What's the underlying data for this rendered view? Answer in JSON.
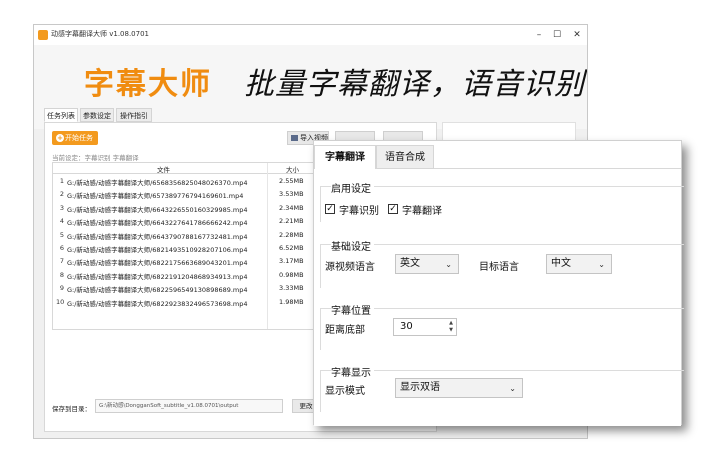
{
  "window": {
    "title": "动感字幕翻译大师 v1.08.0701",
    "minimize": "–",
    "maximize": "☐",
    "close": "✕"
  },
  "banner": {
    "brand": "字幕大师",
    "slogan": "批量字幕翻译，语音识别"
  },
  "tabs": [
    "任务列表",
    "参数设定",
    "操作指引"
  ],
  "toolbar": {
    "start": "开始任务",
    "import": "导入视频"
  },
  "current_settings": "当前设定：字幕识别 字幕翻译",
  "table": {
    "headers": [
      "文件",
      "大小"
    ],
    "rows": [
      {
        "num": "1",
        "file": "G:/新动感/动感字幕翻译大师/6568356825048026370.mp4",
        "size": "2.55MB"
      },
      {
        "num": "2",
        "file": "G:/新动感/动感字幕翻译大师/6573897767941696​01.mp4",
        "size": "3.53MB"
      },
      {
        "num": "3",
        "file": "G:/新动感/动感字幕翻译大师/6643226550160329985.mp4",
        "size": "2.34MB"
      },
      {
        "num": "4",
        "file": "G:/新动感/动感字幕翻译大师/6643227641786666242.mp4",
        "size": "2.21MB"
      },
      {
        "num": "5",
        "file": "G:/新动感/动感字幕翻译大师/6643790788167732481.mp4",
        "size": "2.28MB"
      },
      {
        "num": "6",
        "file": "G:/新动感/动感字幕翻译大师/6821493510928207106.mp4",
        "size": "6.52MB"
      },
      {
        "num": "7",
        "file": "G:/新动感/动感字幕翻译大师/6822175663689043201.mp4",
        "size": "3.17MB"
      },
      {
        "num": "8",
        "file": "G:/新动感/动感字幕翻译大师/6822191204868934913.mp4",
        "size": "0.98MB"
      },
      {
        "num": "9",
        "file": "G:/新动感/动感字幕翻译大师/6822596549130898689.mp4",
        "size": "3.33MB"
      },
      {
        "num": "10",
        "file": "G:/新动感/动感字幕翻译大师/6822923832496573698.mp4",
        "size": "1.98MB"
      }
    ]
  },
  "save": {
    "label": "保存到目录：",
    "path": "G:\\新动感\\DongganSoft_subtitle_v1.08.0701\\output",
    "change": "更改"
  },
  "settings_window": {
    "tabs": [
      "字幕翻译",
      "语音合成"
    ],
    "enable": {
      "title": "启用设定",
      "recognize": "字幕识别",
      "translate": "字幕翻译",
      "check_mark": "✓"
    },
    "basic": {
      "title": "基础设定",
      "source_label": "源视频语言",
      "source_value": "英文",
      "target_label": "目标语言",
      "target_value": "中文"
    },
    "position": {
      "title": "字幕位置",
      "bottom_label": "距离底部",
      "bottom_value": "30"
    },
    "display": {
      "title": "字幕显示",
      "mode_label": "显示模式",
      "mode_value": "显示双语"
    },
    "dropdown_arrow": "⌄",
    "spin_up": "▲",
    "spin_down": "▼"
  },
  "colors": {
    "brand_orange": "#f08c10",
    "button_orange": "#f39a1e"
  }
}
